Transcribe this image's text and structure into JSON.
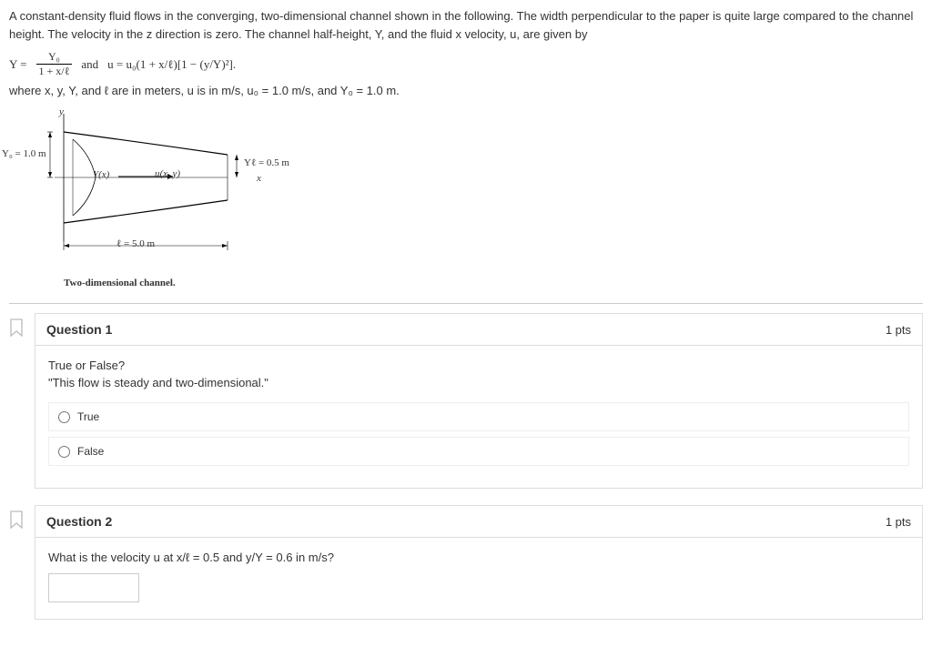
{
  "problem": {
    "intro": "A constant-density fluid flows in the converging, two-dimensional channel shown in the following. The width perpendicular to the paper is quite large compared to the channel height. The velocity in the z direction is zero. The channel half-height, Y, and the fluid x velocity, u, are given by",
    "Y_lhs": "Y =",
    "Y_frac_num": "Y₀",
    "Y_frac_den": "1 + x/ℓ",
    "and_word": "and",
    "u_expr": "u = u₀(1 + x/ℓ)[1 − (y/Y)²].",
    "where": "where x, y, Y, and ℓ are in meters, u is in m/s, u₀ = 1.0 m/s, and Y₀ = 1.0 m."
  },
  "figure": {
    "y_axis": "y",
    "Y0_label": "Y₀ = 1.0 m",
    "Yx_label": "Y(x)",
    "uxy_label": "u(x, y)",
    "Yl_label": "Yℓ = 0.5 m",
    "x_label": "x",
    "ell_label": "ℓ = 5.0 m",
    "caption": "Two-dimensional channel."
  },
  "q1": {
    "title": "Question 1",
    "points": "1 pts",
    "prompt": "True or False?",
    "statement": "\"This flow is steady and two-dimensional.\"",
    "opt_true": "True",
    "opt_false": "False"
  },
  "q2": {
    "title": "Question 2",
    "points": "1 pts",
    "prompt": "What is the velocity u at x/ℓ = 0.5 and y/Y = 0.6 in m/s?",
    "answer_value": ""
  }
}
